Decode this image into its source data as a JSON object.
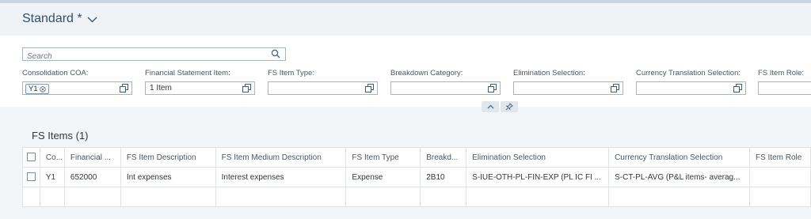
{
  "header": {
    "variant_title": "Standard *",
    "variant_icon": "chevron-down-icon"
  },
  "search": {
    "placeholder": "Search",
    "icon": "search-icon"
  },
  "filters": [
    {
      "label": "Consolidation COA:",
      "token": "Y1",
      "token_icon": "clear-token-icon",
      "value_help_icon": "value-help-icon"
    },
    {
      "label": "Financial Statement Item:",
      "value": "1 Item",
      "value_help_icon": "value-help-icon"
    },
    {
      "label": "FS Item Type:",
      "value": "",
      "value_help_icon": "value-help-icon"
    },
    {
      "label": "Breakdown Category:",
      "value": "",
      "value_help_icon": "value-help-icon"
    },
    {
      "label": "Elimination Selection:",
      "value": "",
      "value_help_icon": "value-help-icon"
    },
    {
      "label": "Currency Translation Selection:",
      "value": "",
      "value_help_icon": "value-help-icon"
    },
    {
      "label": "FS Item Role:",
      "value": ""
    }
  ],
  "filterbar_controls": {
    "collapse_icon": "chevron-up-icon",
    "pin_icon": "pin-icon"
  },
  "table": {
    "title": "FS Items (1)",
    "columns": [
      "Co...",
      "Financial ...",
      "FS Item Description",
      "FS Item Medium Description",
      "FS Item Type",
      "Breakd...",
      "Elimination Selection",
      "Currency Translation Selection",
      "FS Item Role"
    ],
    "rows": [
      [
        "Y1",
        "652000",
        "Int expenses",
        "Interest expenses",
        "Expense",
        "2B10",
        "S-IUE-OTH-PL-FIN-EXP (PL IC FI ...",
        "S-CT-PL-AVG (P&L items- averag...",
        ""
      ]
    ]
  },
  "colors": {
    "title": "#2f4f6e",
    "accent": "#0a6ed1",
    "border": "#a8b3bd"
  }
}
